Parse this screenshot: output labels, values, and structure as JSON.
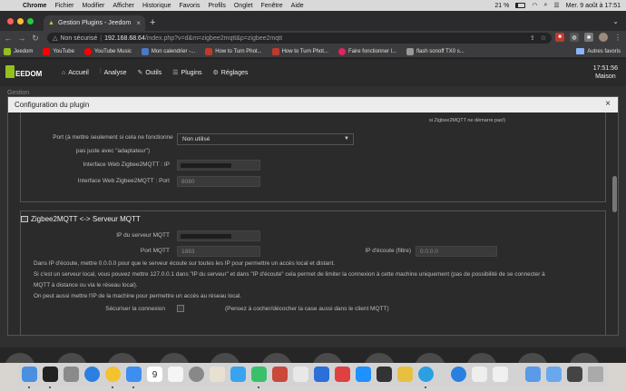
{
  "menubar": {
    "app": "Chrome",
    "items": [
      "Fichier",
      "Modifier",
      "Afficher",
      "Historique",
      "Favoris",
      "Profils",
      "Onglet",
      "Fenêtre",
      "Aide"
    ],
    "battery": "21 %",
    "datetime": "Mer. 9 août à 17:51"
  },
  "browser": {
    "tab_title": "Gestion Plugins - Jeedom",
    "security": "Non sécurisé",
    "url_host": "192.168.68.64",
    "url_path": "/index.php?v=d&m=zigbee2mqtt&p=zigbee2mqtt",
    "bookmarks": [
      "Jeedom",
      "YouTube",
      "YouTube Music",
      "Mon calendrier -...",
      "How to Turn Phot...",
      "How to Turn Phot...",
      "Faire fonctionner l...",
      "flash sonoff TX0 s..."
    ],
    "bookmarks_other": "Autres favoris"
  },
  "jeedom": {
    "logo": "EEDOM",
    "menu": [
      "Accueil",
      "Analyse",
      "Outils",
      "Plugins",
      "Réglages"
    ],
    "time": "17:51:56",
    "location": "Maison",
    "page_title": "Gestion"
  },
  "modal": {
    "title": "Configuration du plugin",
    "top_note": "si Zigbee2MQTT ne démarre pas!)",
    "port_label_1": "Port (à mettre seulement si cela ne fonctionne",
    "port_label_2": "pas juste avec \"adaptateur\")",
    "port_value": "Non utilisé",
    "web_ip_label": "Interface Web Zigbee2MQTT : IP",
    "web_port_label": "Interface Web Zigbee2MQTT : Port",
    "web_port_placeholder": "8080",
    "section_title": "Zigbee2MQTT <-> Serveur MQTT",
    "server_ip_label": "IP du serveur MQTT",
    "mqtt_port_label": "Port MQTT",
    "mqtt_port_placeholder": "1883",
    "listen_ip_label": "IP d'écoute (filtre)",
    "listen_ip_placeholder": "0.0.0.0",
    "help_1": "Dans IP d'écoute, mettre 0.0.0.0 pour que le serveur écoute sur toutes les IP pour permettre un accès local et distant.",
    "help_2": "Si c'est un serveur local, vous pouvez mettre 127.0.0.1 dans \"IP du serveur\" et dans \"IP d'écoute\" cela permet de limiter la connexion à cette machine uniquement (pas de possibilité de se connecter à",
    "help_3": "MQTT à distance ou via le réseau local).",
    "help_4": "On peut aussi mettre l'IP de la machine pour permettre un accès au réseau local.",
    "secure_label": "Sécuriser la connexion",
    "secure_note": "(Pensez à cocher/décocher la case aussi dans le client MQTT)"
  },
  "dock": {
    "calendar_day": "9"
  }
}
